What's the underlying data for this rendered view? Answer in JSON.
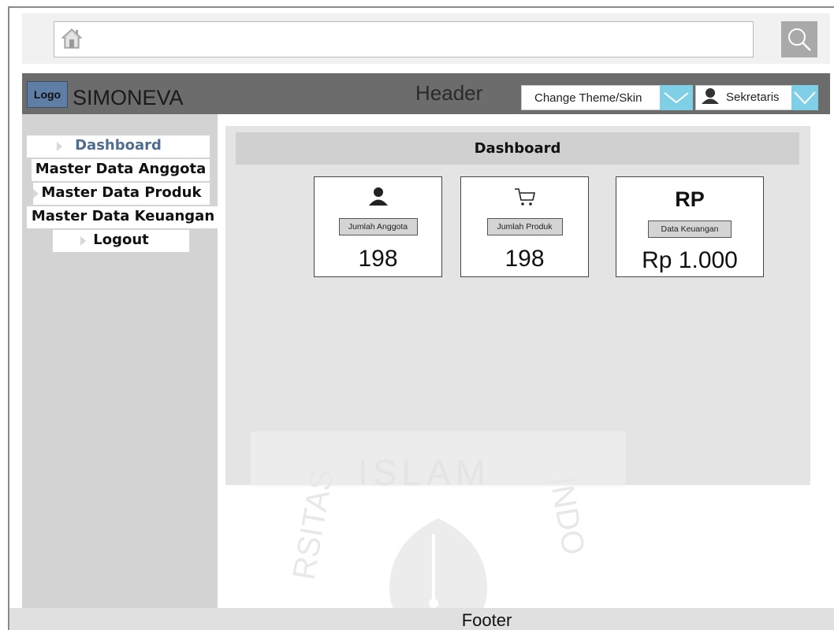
{
  "browser": {
    "address_value": ""
  },
  "header": {
    "logo_text": "Logo",
    "app_name": "SIMONEVA",
    "label": "Header",
    "theme_select_label": "Change Theme/Skin",
    "user_name": "Sekretaris"
  },
  "sidebar": {
    "items": [
      {
        "label": "Dashboard",
        "active": true
      },
      {
        "label": "Master Data Anggota",
        "active": false
      },
      {
        "label": "Master Data Produk",
        "active": false
      },
      {
        "label": "Master Data Keuangan",
        "active": false
      },
      {
        "label": "Logout",
        "active": false
      }
    ]
  },
  "main": {
    "title": "Dashboard",
    "cards": [
      {
        "icon": "user-icon",
        "label": "Jumlah Anggota",
        "value": "198"
      },
      {
        "icon": "cart-icon",
        "label": "Jumlah Produk",
        "value": "198"
      },
      {
        "icon_text": "RP",
        "label": "Data Keuangan",
        "value": "Rp 1.000"
      }
    ]
  },
  "footer": {
    "label": "Footer"
  },
  "colors": {
    "header_bg": "#6c6c6c",
    "sidebar_bg": "#d3d3d3",
    "content_bg": "#e4e4e4",
    "dropdown_accent": "#7fd0e6",
    "logo_bg": "#5f7ea6",
    "active_menu_text": "#4f6e8f"
  }
}
